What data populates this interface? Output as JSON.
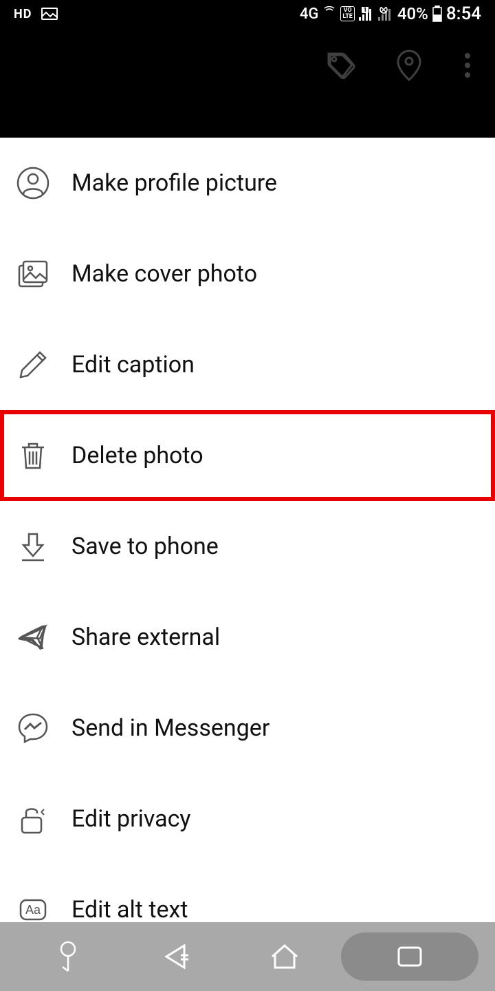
{
  "status_bar": {
    "hd": "HD",
    "network": "4G",
    "volte": "VO LTE",
    "battery": "40%",
    "time": "8:54"
  },
  "menu": {
    "items": [
      {
        "label": "Make profile picture",
        "icon": "profile-icon",
        "highlighted": false
      },
      {
        "label": "Make cover photo",
        "icon": "photo-stack-icon",
        "highlighted": false
      },
      {
        "label": "Edit caption",
        "icon": "pencil-icon",
        "highlighted": false
      },
      {
        "label": "Delete photo",
        "icon": "trash-icon",
        "highlighted": true
      },
      {
        "label": "Save to phone",
        "icon": "download-icon",
        "highlighted": false
      },
      {
        "label": "Share external",
        "icon": "share-icon",
        "highlighted": false
      },
      {
        "label": "Send in Messenger",
        "icon": "messenger-icon",
        "highlighted": false
      },
      {
        "label": "Edit privacy",
        "icon": "lock-icon",
        "highlighted": false
      },
      {
        "label": "Edit alt text",
        "icon": "alt-text-icon",
        "highlighted": false
      }
    ]
  },
  "highlight_color": "#e80000"
}
